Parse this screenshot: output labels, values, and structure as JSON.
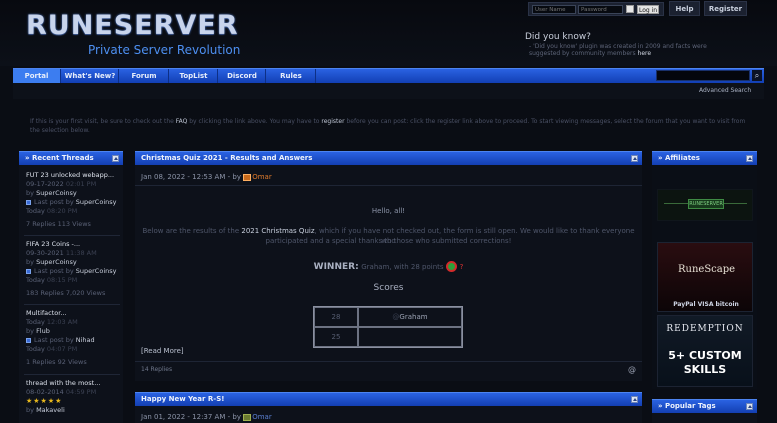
{
  "header": {
    "logo": "RUNESERVER",
    "tagline": "Private Server Revolution",
    "login": {
      "username_placeholder": "User Name",
      "password_placeholder": "Password",
      "login_button": "Log in"
    },
    "help_button": "Help",
    "register_button": "Register",
    "did_you_know_title": "Did you know?",
    "did_you_know_text": "- 'Did you know' plugin was created in 2009 and facts were suggested by community members",
    "did_you_know_link": "here"
  },
  "nav": {
    "items": [
      "Portal",
      "What's New?",
      "Forum",
      "TopList",
      "Discord",
      "Rules"
    ],
    "active_index": 0,
    "advanced_search": "Advanced Search"
  },
  "notice": {
    "p1": "If this is your first visit, be sure to check out the ",
    "faq": "FAQ",
    "p2": " by clicking the link above. You may have to ",
    "register": "register",
    "p3": " before you can post: click the register link above to proceed. To start viewing messages, select the forum that you want to visit from the selection below."
  },
  "recent_threads": {
    "title": "» Recent Threads",
    "threads": [
      {
        "title": "FUT 23 unlocked webapp...",
        "date": "09-17-2022",
        "time": "02:01 PM",
        "by_label": "by",
        "author": "SuperCoinsy",
        "last_post_label": "Last post by",
        "last_user": "SuperCoinsy",
        "last_date": "Today",
        "last_time": "08:20 PM",
        "meta": "7 Replies 113 Views"
      },
      {
        "title": "FIFA 23 Coins -...",
        "date": "09-30-2021",
        "time": "11:38 AM",
        "by_label": "by",
        "author": "SuperCoinsy",
        "last_post_label": "Last post by",
        "last_user": "SuperCoinsy",
        "last_date": "Today",
        "last_time": "08:15 PM",
        "meta": "183 Replies 7,020 Views"
      },
      {
        "title": "Multifactor...",
        "date": "Today",
        "time": "12:03 AM",
        "by_label": "by",
        "author": "Flub",
        "last_post_label": "Last post by",
        "last_user": "Nihad",
        "last_date": "Today",
        "last_time": "04:07 PM",
        "meta": "1 Replies 92 Views"
      },
      {
        "title": "thread with the most...",
        "date": "08-02-2014",
        "time": "04:59 PM",
        "stars": "★★★★★",
        "by_label": "by",
        "author": "Makaveli"
      }
    ]
  },
  "posts": [
    {
      "title": "Christmas Quiz 2021 - Results and Answers",
      "date": "Jan 08, 2022 - 12:53 AM",
      "by_label": "- by",
      "author": "Omar",
      "greeting": "Hello, all!",
      "body1a": "Below are the results of the ",
      "body1_link": "2021 Christmas Quiz",
      "body1b": ", which if you have not checked out, the form is still open. We would like to thank everyone who",
      "body2": "participated and a special thanks to those who submitted corrections!",
      "winner_label": "WINNER:",
      "winner_text": "Graham, with 28 points",
      "scores_title": "Scores",
      "scores": [
        {
          "points": "28",
          "name": "Graham"
        },
        {
          "points": "25",
          "name": ""
        }
      ],
      "read_more": "[Read More]",
      "replies": "14 Replies"
    },
    {
      "title": "Happy New Year R-S!",
      "date": "Jan 01, 2022 - 12:37 AM",
      "by_label": "- by",
      "author": "Omar"
    }
  ],
  "affiliates": {
    "title": "» Affiliates",
    "banner1": "RUNESERVER",
    "banner2_logo": "RuneScape",
    "banner2_payments": "PayPal VISA bitcoin",
    "banner3_title": "REDEMPTION",
    "banner3_line1": "5+ CUSTOM",
    "banner3_line2": "SKILLS"
  },
  "popular_tags": {
    "title": "» Popular Tags"
  },
  "colors": {
    "nav_blue": "#2a62e2",
    "accent_orange": "#e07b2c",
    "star_gold": "#e8b81c"
  }
}
